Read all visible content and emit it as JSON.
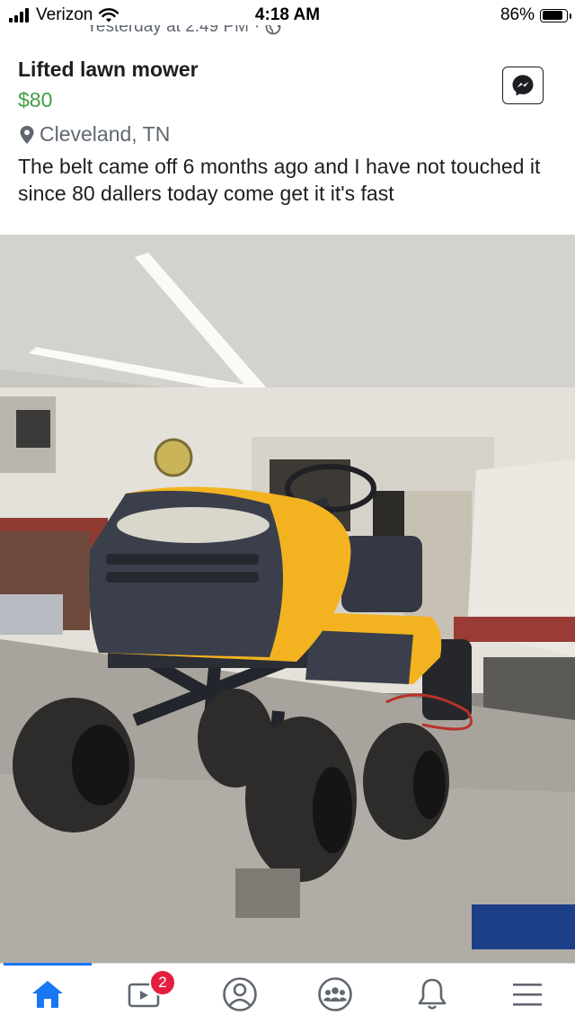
{
  "status_bar": {
    "carrier": "Verizon",
    "time": "4:18 AM",
    "battery_percent": "86%",
    "battery_level": 0.86,
    "signal_bars": 4
  },
  "post": {
    "timestamp": "Yesterday at 2:49 PM",
    "timestamp_separator": "·",
    "privacy_icon": "globe-icon"
  },
  "listing": {
    "title": "Lifted lawn mower",
    "price": "$80",
    "location": "Cleveland, TN",
    "description": "The belt came off 6 months ago and I have not touched it since 80 dallers today come get it it's fast",
    "message_button_icon": "messenger-icon"
  },
  "photo": {
    "subject": "lifted-riding-mower-photo"
  },
  "bottom_nav": {
    "items": [
      {
        "icon": "home-icon",
        "active": true
      },
      {
        "icon": "video-icon",
        "badge": "2"
      },
      {
        "icon": "profile-icon"
      },
      {
        "icon": "groups-icon"
      },
      {
        "icon": "bell-icon"
      },
      {
        "icon": "menu-icon"
      }
    ]
  },
  "colors": {
    "price": "#42a046",
    "accent": "#1877f2",
    "badge": "#e41e3f",
    "mower_body": "#f3b321",
    "mower_dark": "#3a3f4b"
  }
}
